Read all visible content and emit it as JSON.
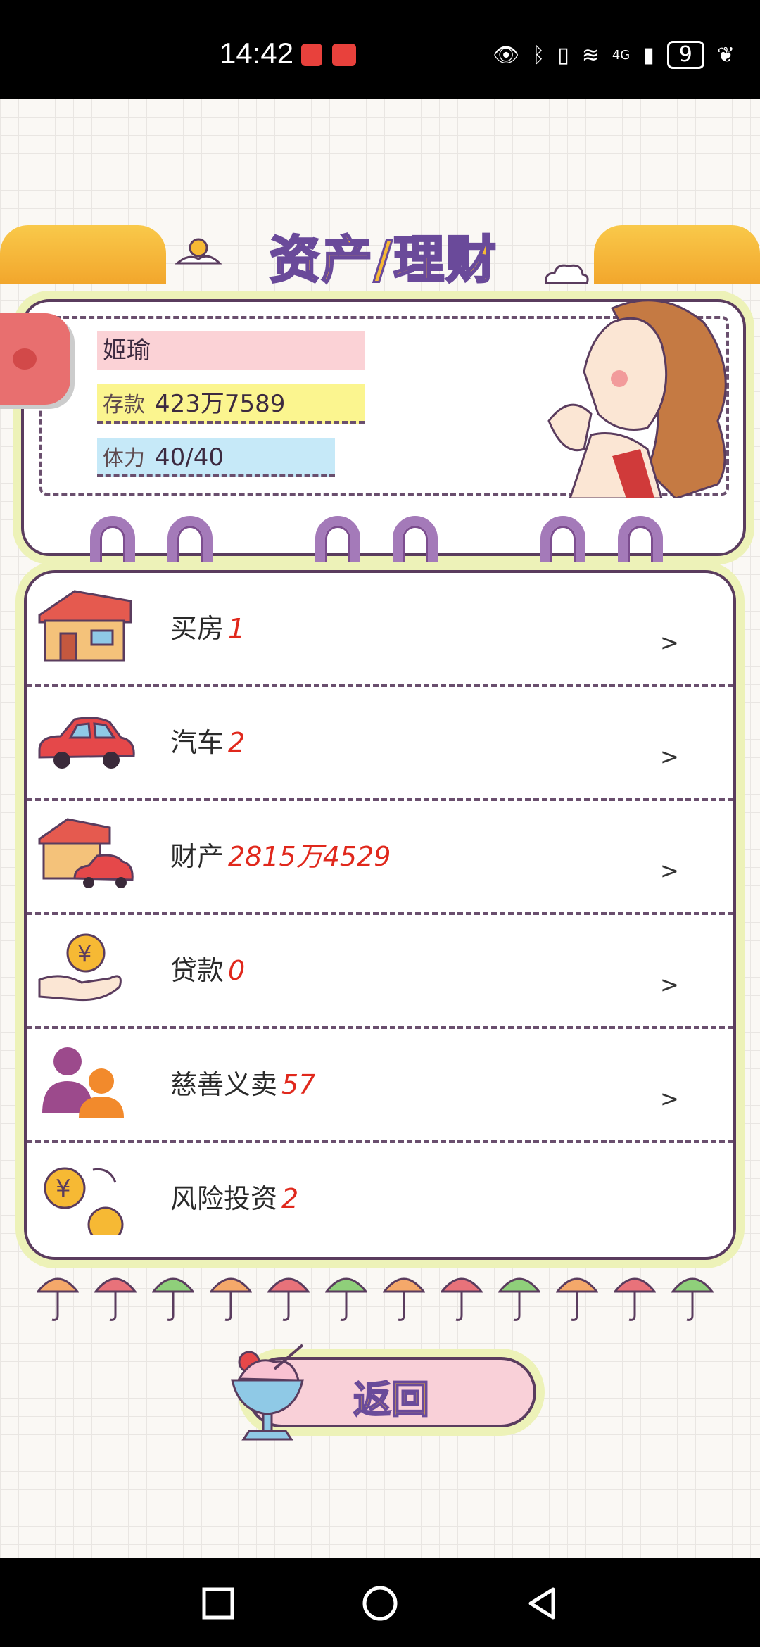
{
  "status_bar": {
    "time": "14:42",
    "battery": "9",
    "network": "4G"
  },
  "header": {
    "title": "资产/理财"
  },
  "profile": {
    "name": "姬瑜",
    "savings_label": "存款",
    "savings_value": "423万7589",
    "stamina_label": "体力",
    "stamina_value": "40/40"
  },
  "items": [
    {
      "label": "买房",
      "value": "1",
      "icon": "house-icon"
    },
    {
      "label": "汽车",
      "value": "2",
      "icon": "car-icon"
    },
    {
      "label": "财产",
      "value": "2815万4529",
      "icon": "property-icon"
    },
    {
      "label": "贷款",
      "value": "0",
      "icon": "loan-icon"
    },
    {
      "label": "慈善义卖",
      "value": "57",
      "icon": "charity-icon"
    },
    {
      "label": "风险投资",
      "value": "2",
      "icon": "investment-icon"
    }
  ],
  "chevron": ">",
  "back_button": {
    "label": "返回"
  },
  "colors": {
    "accent_title": "#f6b934",
    "outline": "#5a3c5e",
    "value_red": "#e0281c"
  }
}
